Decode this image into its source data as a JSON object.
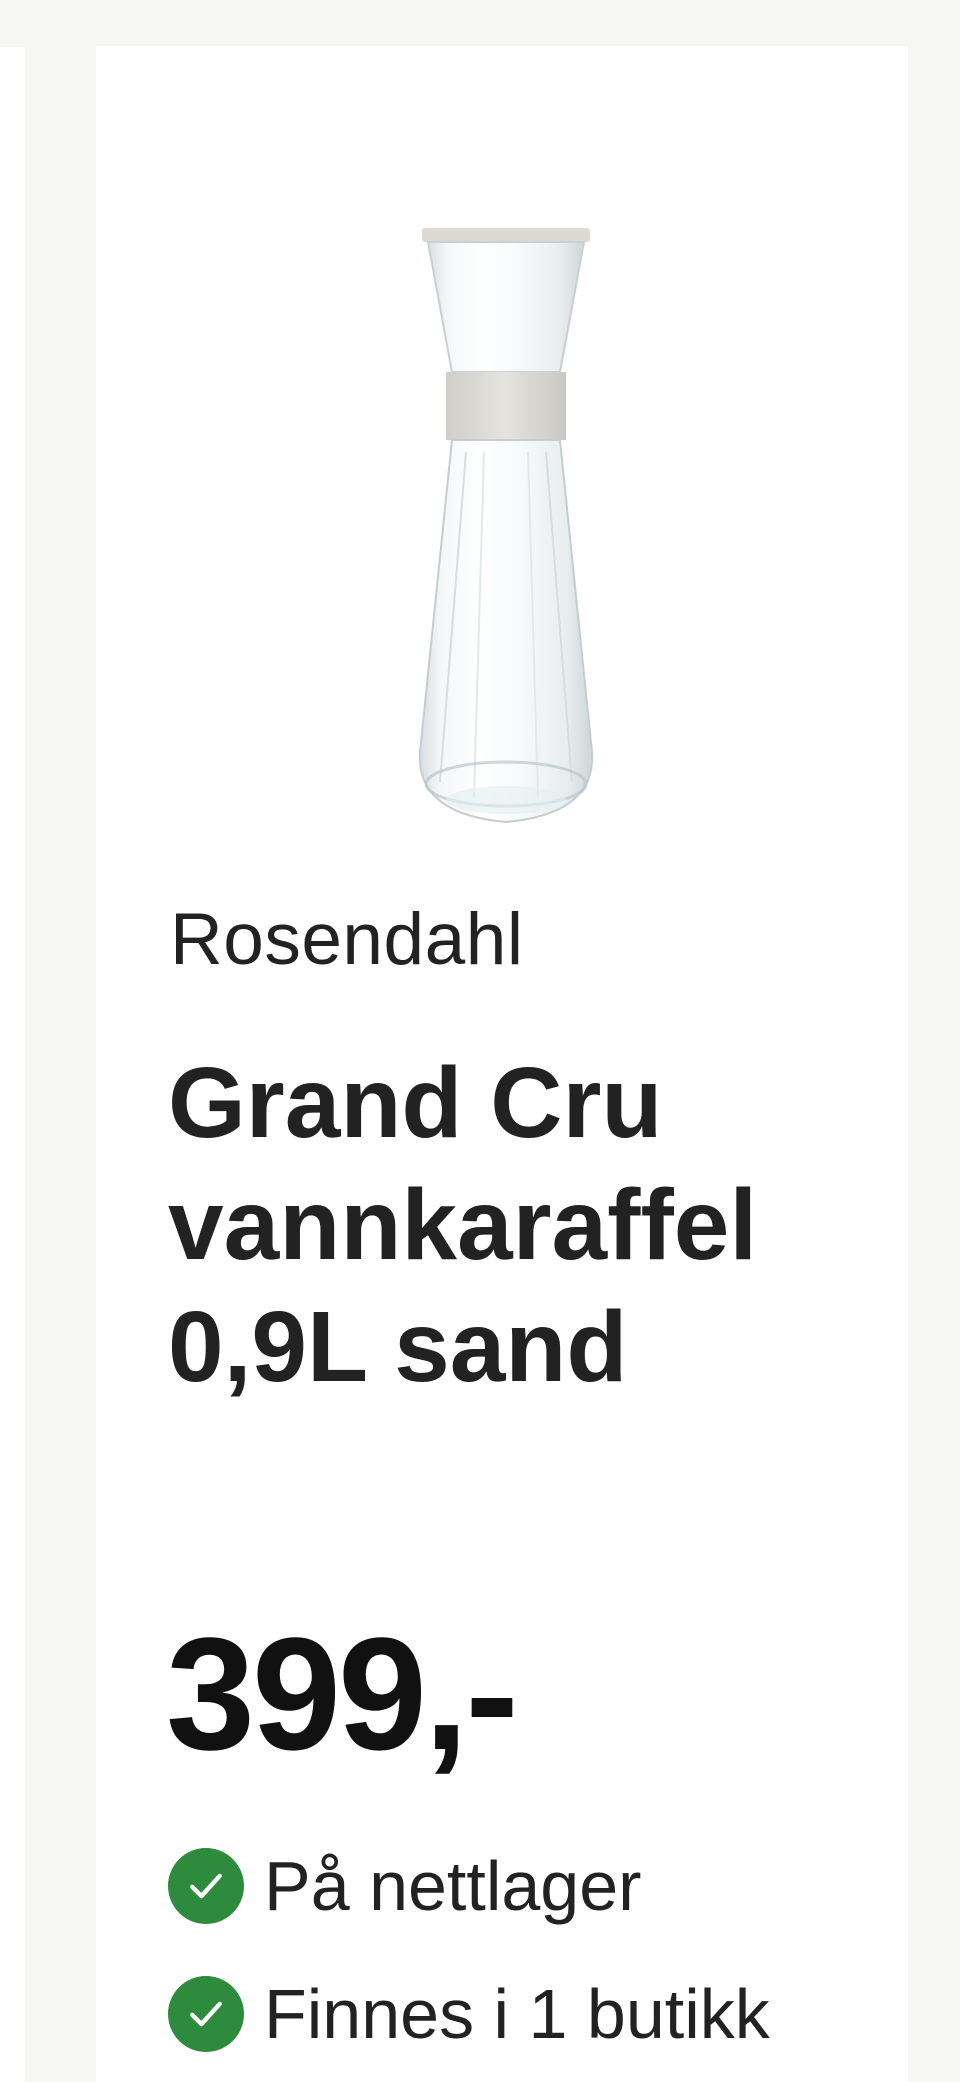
{
  "colors": {
    "background": "#f6f6f5",
    "card": "#ffffff",
    "text": "#222222",
    "price": "#111111",
    "in_stock": "#2e8b3d"
  },
  "product": {
    "image_icon": "water-carafe",
    "brand": "Rosendahl",
    "title_lines": [
      "Grand Cru",
      "vannkaraffel",
      "0,9L sand"
    ],
    "price": "399,-"
  },
  "availability": [
    {
      "icon": "check-circle-icon",
      "text": "På nettlager"
    },
    {
      "icon": "check-circle-icon",
      "text": "Finnes i 1 butikk"
    }
  ]
}
